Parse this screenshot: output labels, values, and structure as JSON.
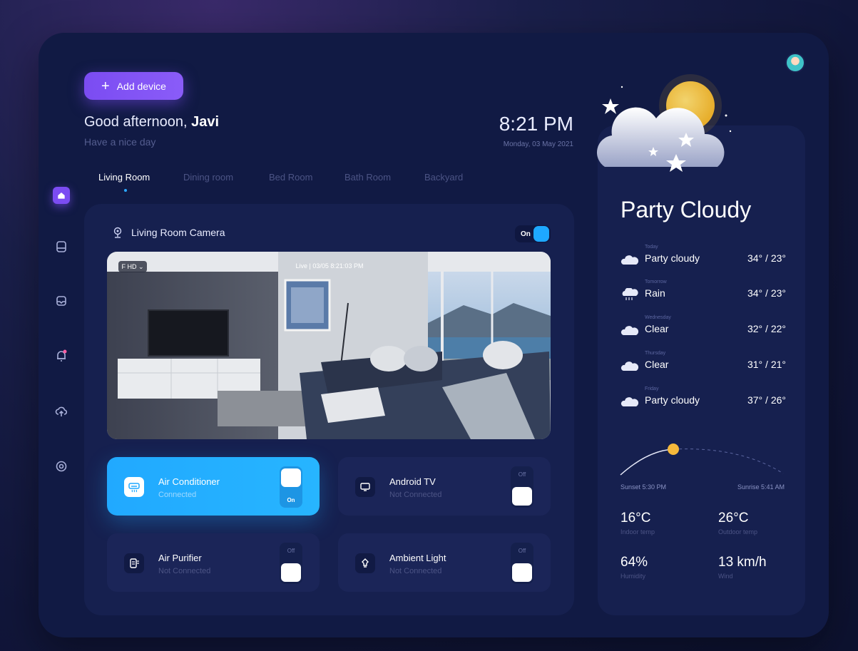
{
  "header": {
    "add_device_label": "Add device",
    "greeting_prefix": "Good afternoon, ",
    "user_name": "Javi",
    "subgreeting": "Have a nice day",
    "time": "8:21 PM",
    "date": "Monday, 03 May 2021"
  },
  "sidebar": {
    "items": [
      {
        "icon": "home-icon",
        "active": true
      },
      {
        "icon": "device-icon",
        "active": false
      },
      {
        "icon": "inbox-icon",
        "active": false
      },
      {
        "icon": "bell-icon",
        "active": false,
        "badge": true
      },
      {
        "icon": "cloud-upload-icon",
        "active": false
      },
      {
        "icon": "settings-icon",
        "active": false
      }
    ]
  },
  "tabs": [
    {
      "label": "Living Room",
      "active": true
    },
    {
      "label": "Dining room",
      "active": false
    },
    {
      "label": "Bed Room",
      "active": false
    },
    {
      "label": "Bath Room",
      "active": false
    },
    {
      "label": "Backyard",
      "active": false
    }
  ],
  "camera": {
    "title": "Living Room Camera",
    "toggle_label": "On",
    "resolution": "F HD ⌄",
    "live_label": "Live | 03/05 8:21:03 PM"
  },
  "devices": [
    {
      "name": "Air Conditioner",
      "status": "Connected",
      "switch_label": "On",
      "on": true,
      "icon": "air-conditioner-icon"
    },
    {
      "name": "Android TV",
      "status": "Not Connected",
      "switch_label": "Off",
      "on": false,
      "icon": "tv-icon"
    },
    {
      "name": "Air Purifier",
      "status": "Not Connected",
      "switch_label": "Off",
      "on": false,
      "icon": "air-purifier-icon"
    },
    {
      "name": "Ambient Light",
      "status": "Not Connected",
      "switch_label": "Off",
      "on": false,
      "icon": "light-bulb-icon"
    }
  ],
  "weather": {
    "title": "Party Cloudy",
    "forecast": [
      {
        "day": "Today",
        "condition": "Party cloudy",
        "temp": "34° / 23°",
        "icon": "cloud-icon"
      },
      {
        "day": "Tomorrow",
        "condition": "Rain",
        "temp": "34° / 23°",
        "icon": "rain-icon"
      },
      {
        "day": "Wednesday",
        "condition": "Clear",
        "temp": "32° / 22°",
        "icon": "cloud-icon"
      },
      {
        "day": "Thursday",
        "condition": "Clear",
        "temp": "31° / 21°",
        "icon": "cloud-icon"
      },
      {
        "day": "Friday",
        "condition": "Party cloudy",
        "temp": "37° / 26°",
        "icon": "cloud-icon"
      }
    ],
    "sunset": "Sunset 5:30 PM",
    "sunrise": "Sunrise 5:41 AM",
    "stats": [
      {
        "value": "16°C",
        "label": "Indoor temp"
      },
      {
        "value": "26°C",
        "label": "Outdoor temp"
      },
      {
        "value": "64%",
        "label": "Humidity"
      },
      {
        "value": "13 km/h",
        "label": "Wind"
      }
    ]
  },
  "colors": {
    "accent_purple": "#7b4cf2",
    "accent_blue": "#21a9ff",
    "panel": "#16204f",
    "background": "#111a44"
  }
}
